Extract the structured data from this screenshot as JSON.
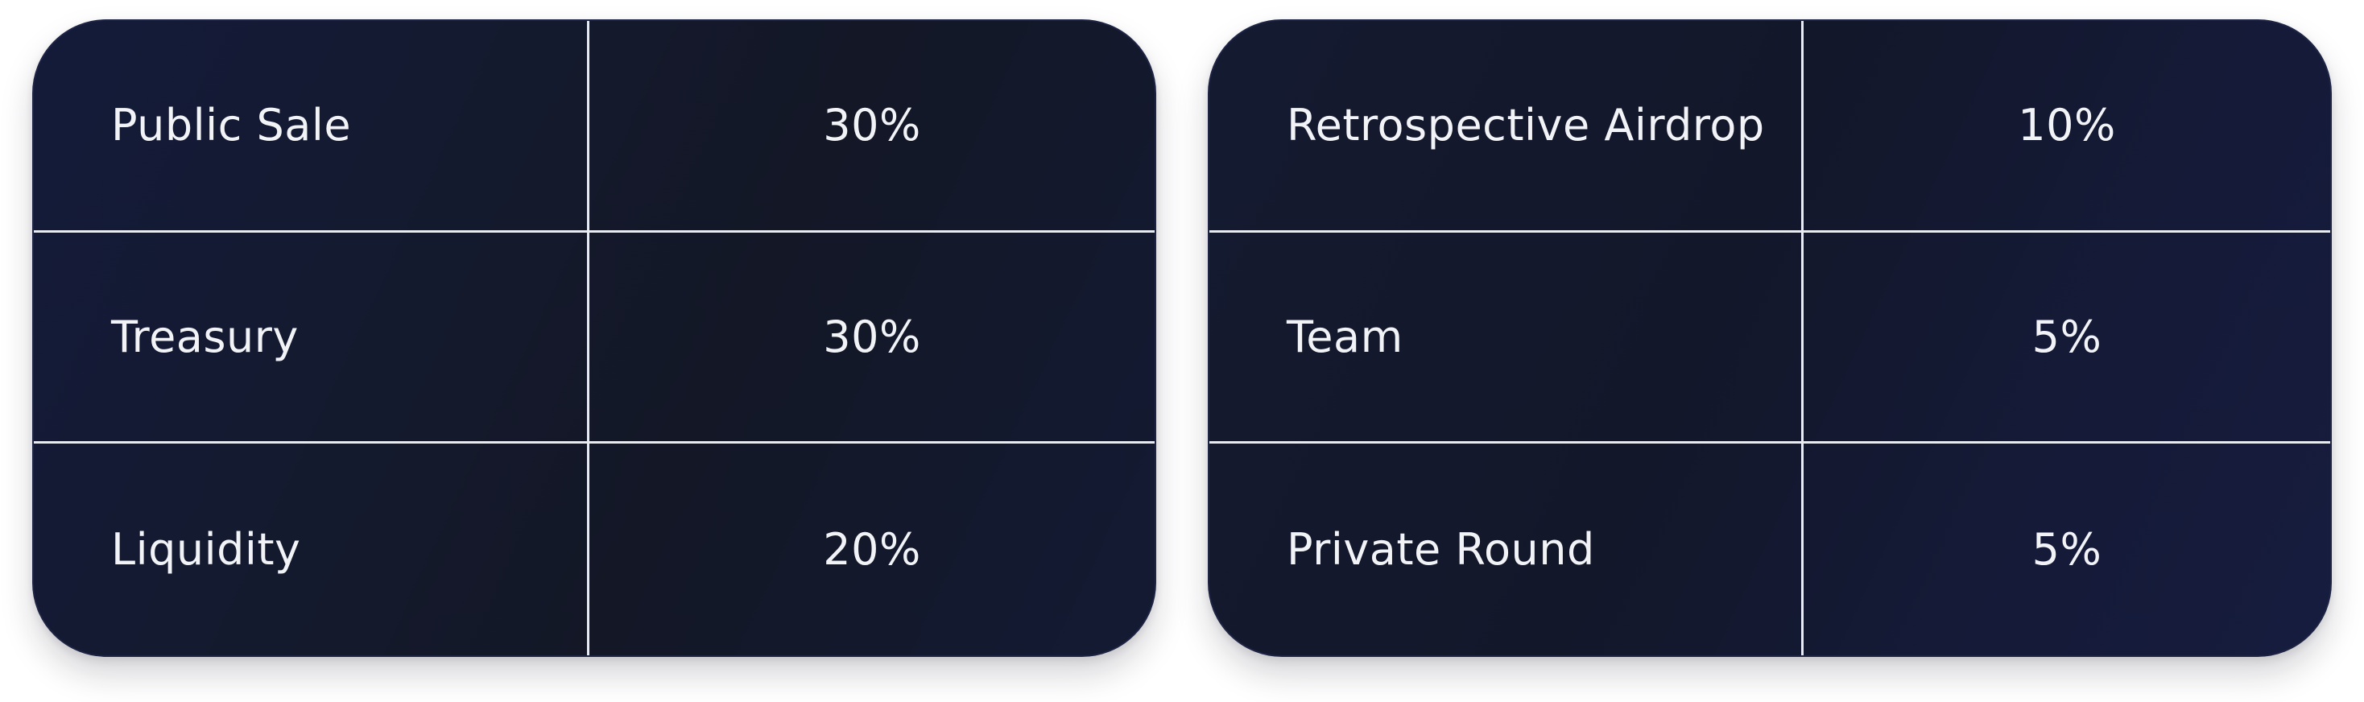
{
  "tables": [
    {
      "rows": [
        {
          "label": "Public Sale",
          "value": "30%"
        },
        {
          "label": "Treasury",
          "value": "30%"
        },
        {
          "label": "Liquidity",
          "value": "20%"
        }
      ]
    },
    {
      "rows": [
        {
          "label": "Retrospective Airdrop",
          "value": "10%"
        },
        {
          "label": "Team",
          "value": "5%"
        },
        {
          "label": "Private Round",
          "value": "5%"
        }
      ]
    }
  ],
  "colors": {
    "card_background": "#131726",
    "grid_line": "#e9ebf2",
    "text": "#f2f3f7"
  }
}
